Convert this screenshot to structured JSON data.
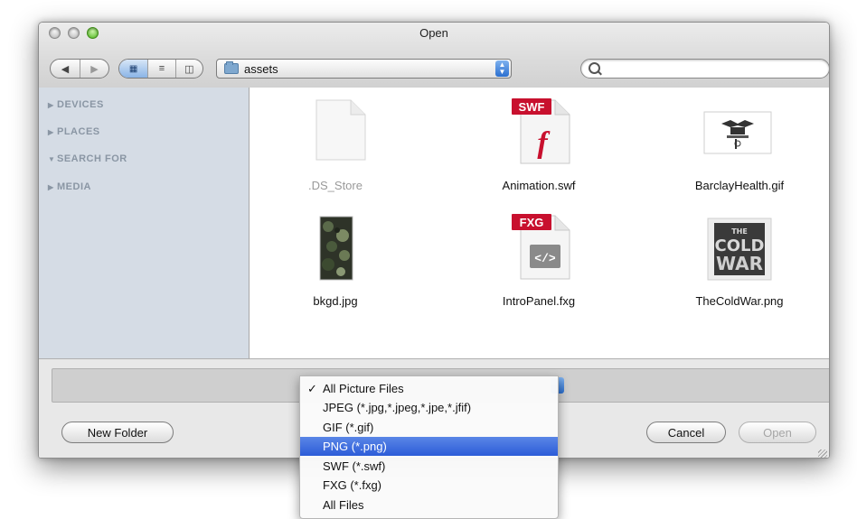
{
  "window": {
    "title": "Open"
  },
  "toolbar": {
    "back_icon": "back-arrow",
    "forward_icon": "forward-arrow",
    "view_icons": [
      "icon-view",
      "list-view",
      "column-view"
    ],
    "location": "assets",
    "search_placeholder": ""
  },
  "sidebar": {
    "items": [
      {
        "label": "DEVICES",
        "expanded": false
      },
      {
        "label": "PLACES",
        "expanded": false
      },
      {
        "label": "SEARCH FOR",
        "expanded": true
      },
      {
        "label": "MEDIA",
        "expanded": false
      }
    ]
  },
  "files": [
    {
      "name": ".DS_Store",
      "kind": "blank-document",
      "dimmed": true
    },
    {
      "name": "Animation.swf",
      "kind": "swf",
      "badge": "SWF",
      "dimmed": false
    },
    {
      "name": "BarclayHealth.gif",
      "kind": "image-logo",
      "dimmed": false
    },
    {
      "name": "bkgd.jpg",
      "kind": "image-camo",
      "dimmed": false
    },
    {
      "name": "IntroPanel.fxg",
      "kind": "fxg",
      "badge": "FXG",
      "dimmed": false
    },
    {
      "name": "TheColdWar.png",
      "kind": "image-poster",
      "thumb_text": [
        "THE",
        "COLD",
        "WAR"
      ],
      "dimmed": false
    }
  ],
  "buttons": {
    "new_folder": "New Folder",
    "cancel": "Cancel",
    "open": "Open"
  },
  "file_type_menu": {
    "items": [
      {
        "label": "All Picture Files",
        "checked": true,
        "highlighted": false
      },
      {
        "label": "JPEG (*.jpg,*.jpeg,*.jpe,*.jfif)",
        "checked": false,
        "highlighted": false
      },
      {
        "label": "GIF (*.gif)",
        "checked": false,
        "highlighted": false
      },
      {
        "label": "PNG (*.png)",
        "checked": false,
        "highlighted": true
      },
      {
        "label": "SWF (*.swf)",
        "checked": false,
        "highlighted": false
      },
      {
        "label": "FXG (*.fxg)",
        "checked": false,
        "highlighted": false
      },
      {
        "label": "All Files",
        "checked": false,
        "highlighted": false
      }
    ],
    "check_glyph": "✓"
  },
  "colors": {
    "accent": "#2c5cd8",
    "swf_badge": "#c8102e",
    "fxg_badge": "#c8102e"
  }
}
